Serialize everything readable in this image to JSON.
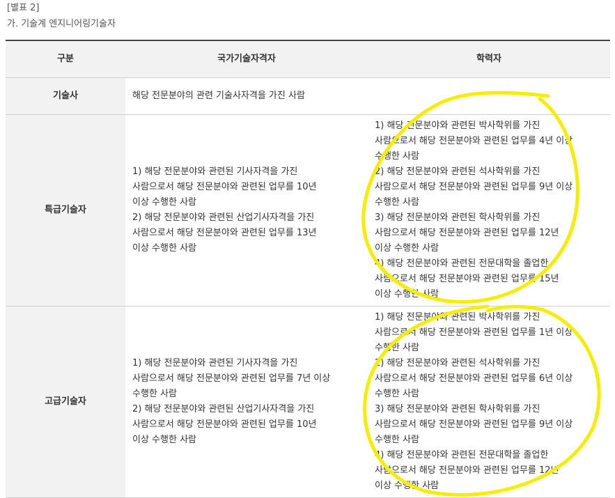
{
  "caption": {
    "label": "[별표 2]",
    "title": "가. 기술계 엔지니어링기술자"
  },
  "table": {
    "headers": [
      "구분",
      "국가기술자격자",
      "학력자"
    ],
    "rows": [
      {
        "grade": "기술사",
        "merged": "해당 전문분야의 관련 기술사자격을 가진 사람"
      },
      {
        "grade": "특급기술자",
        "license": [
          "1) 해당 전문분야와 관련된 기사자격을 가진",
          "사람으로서 해당 전문분야와 관련된 업무를 10년",
          "이상 수행한 사람",
          "2) 해당 전문분야와 관련된 산업기사자격을 가진",
          "사람으로서 해당 전문분야와 관련된 업무를 13년",
          "이상 수행한 사람"
        ],
        "education": [
          "1) 해당 전문분야와 관련된 박사학위를 가진",
          "사람으로서 해당 전문분야와 관련된 업무를 4년 이상",
          "수행한 사람",
          "2) 해당 전문분야와 관련된 석사학위를 가진",
          "사람으로서 해당 전문분야와 관련된 업무를 9년 이상",
          "수행한 사람",
          "3) 해당 전문분야와 관련된 학사학위를 가진",
          "사람으로서 해당 전문분야와 관련된 업무를 12년",
          "이상 수행한 사람",
          "4) 해당 전문분야와 관련된 전문대학을 졸업한",
          "사람으로서 해당 전문분야와 관련된 업무를 15년",
          "이상 수행한 사람"
        ]
      },
      {
        "grade": "고급기술자",
        "license": [
          "1) 해당 전문분야와 관련된 기사자격을 가진",
          "사람으로서 해당 전문분야와 관련된 업무를 7년 이상",
          "수행한 사람",
          "2) 해당 전문분야와 관련된 산업기사자격을 가진",
          "사람으로서 해당 전문분야와 관련된 업무를 10년",
          "이상 수행한 사람"
        ],
        "education": [
          "1) 해당 전문분야와 관련된 박사학위를 가진",
          "사람으로서 해당 전문분야와 관련된 업무를 1년 이상",
          "수행한 사람",
          "2) 해당 전문분야와 관련된 석사학위를 가진",
          "사람으로서 해당 전문분야와 관련된 업무를 6년 이상",
          "수행한 사람",
          "3) 해당 전문분야와 관련된 학사학위를 가진",
          "사람으로서 해당 전문분야와 관련된 업무를 9년 이상",
          "수행한 사람",
          "4) 해당 전문분야와 관련된 전문대학을 졸업한",
          "사람으로서 해당 전문분야와 관련된 업무를 12년",
          "이상 수행한 사람"
        ]
      }
    ]
  },
  "annotation_color": "#f5ee00"
}
